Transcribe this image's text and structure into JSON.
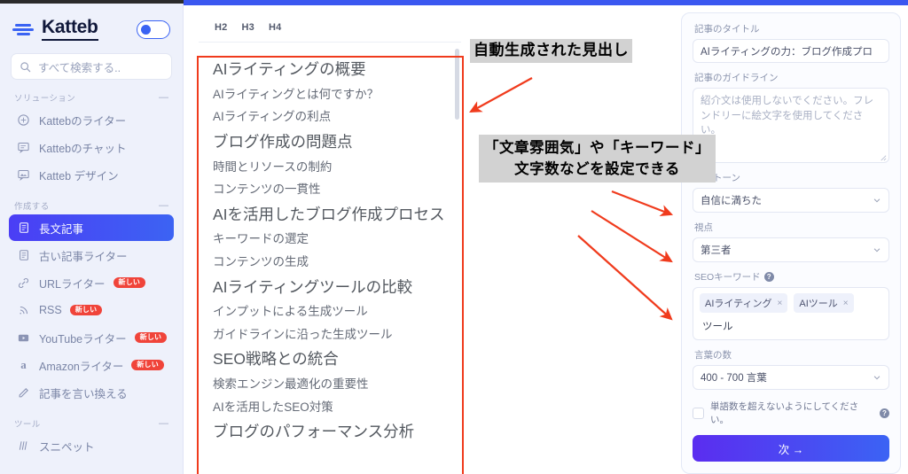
{
  "sidebar": {
    "brand": "Katteb",
    "search_placeholder": "すべて検索する..",
    "sections": [
      {
        "title": "ソリューション",
        "collapse": "—"
      },
      {
        "title": "作成する",
        "collapse": "—"
      },
      {
        "title": "ツール",
        "collapse": "—"
      }
    ],
    "solutions": [
      {
        "label": "Kattebのライター",
        "icon": "pen-circle-icon",
        "badge": ""
      },
      {
        "label": "Kattebのチャット",
        "icon": "chat-bubble-icon",
        "badge": ""
      },
      {
        "label": "Katteb デザイン",
        "icon": "image-bubble-icon",
        "badge": ""
      }
    ],
    "create": [
      {
        "label": "長文記事",
        "icon": "document-icon",
        "badge": "",
        "active": true
      },
      {
        "label": "古い記事ライター",
        "icon": "document-icon",
        "badge": "",
        "active": false
      },
      {
        "label": "URLライター",
        "icon": "link-icon",
        "badge": "新しい",
        "active": false
      },
      {
        "label": "RSS",
        "icon": "rss-icon",
        "badge": "新しい",
        "active": false
      },
      {
        "label": "YouTubeライター",
        "icon": "youtube-icon",
        "badge": "新しい",
        "active": false
      },
      {
        "label": "Amazonライター",
        "icon": "amazon-icon",
        "badge": "新しい",
        "active": false
      },
      {
        "label": "記事を言い換える",
        "icon": "pencil-icon",
        "badge": "",
        "active": false
      }
    ],
    "tools": [
      {
        "label": "スニペット",
        "icon": "snippet-icon",
        "badge": ""
      }
    ]
  },
  "main": {
    "heading_tabs": [
      "H2",
      "H3",
      "H4"
    ],
    "outline": [
      {
        "level": "h2",
        "text": "AIライティングの概要"
      },
      {
        "level": "h3",
        "text": "AIライティングとは何ですか？"
      },
      {
        "level": "h3",
        "text": "AIライティングの利点"
      },
      {
        "level": "h2",
        "text": "ブログ作成の問題点"
      },
      {
        "level": "h3",
        "text": "時間とリソースの制約"
      },
      {
        "level": "h3",
        "text": "コンテンツの一貫性"
      },
      {
        "level": "h2",
        "text": "AIを活用したブログ作成プロセス"
      },
      {
        "level": "h3",
        "text": "キーワードの選定"
      },
      {
        "level": "h3",
        "text": "コンテンツの生成"
      },
      {
        "level": "h2",
        "text": "AIライティングツールの比較"
      },
      {
        "level": "h3",
        "text": "インプットによる生成ツール"
      },
      {
        "level": "h3",
        "text": "ガイドラインに沿った生成ツール"
      },
      {
        "level": "h2",
        "text": "SEO戦略との統合"
      },
      {
        "level": "h3",
        "text": "検索エンジン最適化の重要性"
      },
      {
        "level": "h3",
        "text": "AIを活用したSEO対策"
      },
      {
        "level": "h2",
        "text": "ブログのパフォーマンス分析"
      }
    ]
  },
  "right_panel": {
    "title_label": "記事のタイトル",
    "title_value": "AIライティングの力：ブログ作成プロ",
    "guideline_label": "記事のガイドライン",
    "guideline_placeholder": "紹介文は使用しないでください。フレンドリーに絵文字を使用してください。",
    "tone_label": "声のトーン",
    "tone_value": "自信に満ちた",
    "pov_label": "視点",
    "pov_value": "第三者",
    "seo_label": "SEOキーワード",
    "seo_help": "?",
    "seo_tags": [
      "AIライティング",
      "AIツール"
    ],
    "seo_tag_remove": "×",
    "seo_input_value": "ツール",
    "words_label": "言葉の数",
    "words_value": "400 - 700 言葉",
    "limit_checkbox_label": "単語数を超えないようにしてください。",
    "limit_help": "?",
    "next_button": "次  →"
  },
  "annotations": {
    "callout1": "自動生成された見出し",
    "callout2": "「文章雰囲気」や「キーワード」\n文字数などを設定できる",
    "arrow_color": "#f03b1d",
    "box_color": "#f03b1d",
    "highlight_bg": "#d2d2d2"
  }
}
